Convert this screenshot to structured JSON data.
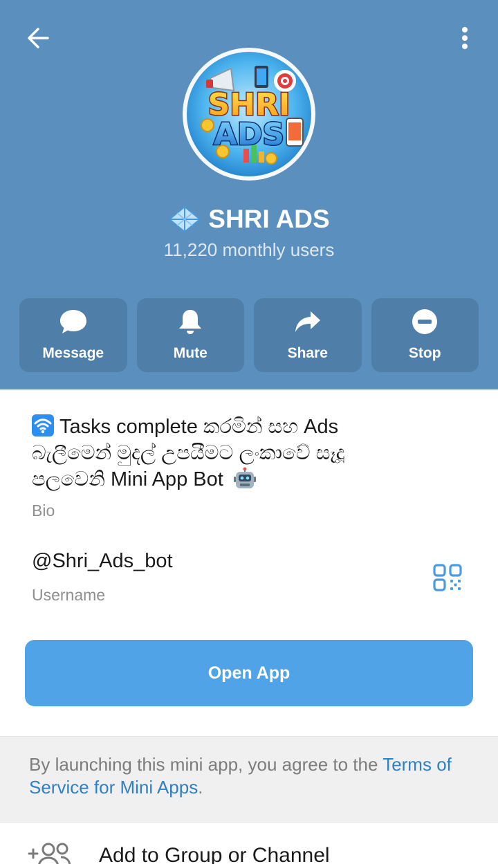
{
  "header": {
    "name": "SHRI ADS",
    "subtitle": "11,220 monthly users",
    "avatar_text_top": "SHRI",
    "avatar_text_bottom": "ADS"
  },
  "actions": [
    {
      "label": "Message",
      "icon": "message-icon"
    },
    {
      "label": "Mute",
      "icon": "bell-icon"
    },
    {
      "label": "Share",
      "icon": "share-icon"
    },
    {
      "label": "Stop",
      "icon": "stop-icon"
    }
  ],
  "bio": {
    "line1": "Tasks complete කරමින් සහ Ads",
    "line2": "බැලීමෙන් මුදල් උපයීමට ලංකාවේ සෑදූ",
    "line3": "පලවෙනි Mini App Bot",
    "caption": "Bio"
  },
  "username": {
    "value": "@Shri_Ads_bot",
    "caption": "Username"
  },
  "open_app_label": "Open App",
  "terms": {
    "prefix": "By launching this mini app, you agree to the ",
    "link": "Terms of Service for Mini Apps",
    "suffix": "."
  },
  "add_to_group_label": "Add to Group or Channel",
  "colors": {
    "header_bg": "#5b8fbd",
    "action_bg": "#4f7fa9",
    "primary_button": "#50a3e6",
    "link": "#2f80c4"
  }
}
